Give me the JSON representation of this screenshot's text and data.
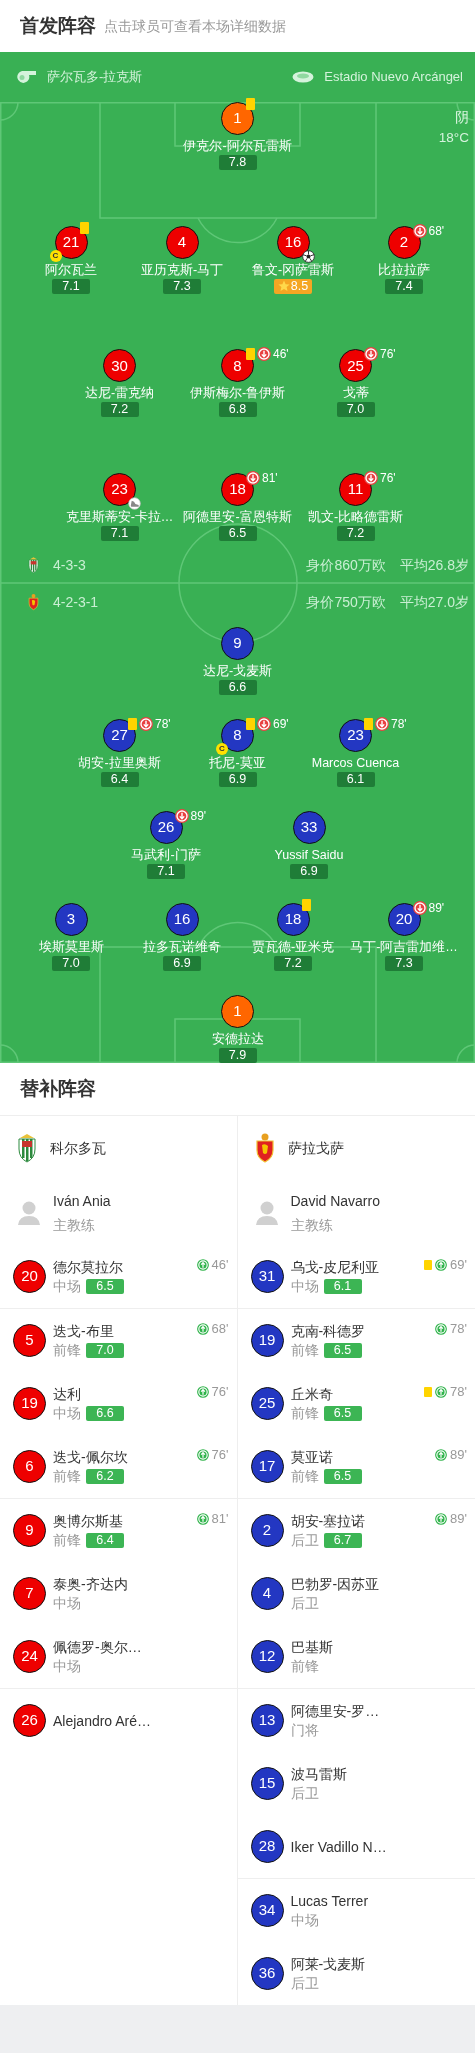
{
  "header": {
    "title": "首发阵容",
    "hint": "点击球员可查看本场详细数据"
  },
  "match_info": {
    "referee": "萨尔瓦多-拉克斯",
    "venue": "Estadio Nuevo Arcángel",
    "weather": "阴",
    "temperature": "18°C"
  },
  "teams": [
    {
      "color": "#ee0000",
      "formation": "4-3-3",
      "value": "身价860万欧",
      "avg_age": "平均26.8岁",
      "lines": [
        [
          {
            "number": "1",
            "name": "伊克尔-阿尔瓦雷斯",
            "rating": "7.8",
            "kind": "goalkeeper",
            "yellow_card": true
          }
        ],
        [
          {
            "number": "21",
            "name": "阿尔瓦兰",
            "rating": "7.1",
            "kind": "outfield",
            "yellow_card": true,
            "captain_badge": "C"
          },
          {
            "number": "4",
            "name": "亚历克斯-马丁",
            "rating": "7.3",
            "kind": "outfield",
            "yellow_card": false
          },
          {
            "number": "16",
            "name": "鲁文-冈萨雷斯",
            "rating": "8.5",
            "kind": "outfield",
            "yellow_card": false,
            "goal": true,
            "best": true
          },
          {
            "number": "2",
            "name": "比拉拉萨",
            "rating": "7.4",
            "kind": "outfield",
            "yellow_card": false,
            "sub_out": "68'"
          }
        ],
        [
          {
            "number": "30",
            "name": "达尼-雷克纳",
            "rating": "7.2",
            "kind": "outfield",
            "yellow_card": false
          },
          {
            "number": "8",
            "name": "伊斯梅尔-鲁伊斯",
            "rating": "6.8",
            "kind": "outfield",
            "yellow_card": true,
            "sub_out": "46'"
          },
          {
            "number": "25",
            "name": "戈蒂",
            "rating": "7.0",
            "kind": "outfield",
            "yellow_card": false,
            "sub_out": "76'"
          }
        ],
        [
          {
            "number": "23",
            "name": "克里斯蒂安-卡拉…",
            "rating": "7.1",
            "kind": "outfield",
            "yellow_card": false,
            "assist": true
          },
          {
            "number": "18",
            "name": "阿德里安-富恩特斯",
            "rating": "6.5",
            "kind": "outfield",
            "yellow_card": false,
            "sub_out": "81'"
          },
          {
            "number": "11",
            "name": "凯文-比略德雷斯",
            "rating": "7.2",
            "kind": "outfield",
            "yellow_card": false,
            "sub_out": "76'"
          }
        ]
      ]
    },
    {
      "color": "#2337c2",
      "formation": "4-2-3-1",
      "value": "身价750万欧",
      "avg_age": "平均27.0岁",
      "lines": [
        [
          {
            "number": "9",
            "name": "达尼-戈麦斯",
            "rating": "6.6",
            "kind": "outfield",
            "yellow_card": false
          }
        ],
        [
          {
            "number": "27",
            "name": "胡安-拉里奥斯",
            "rating": "6.4",
            "kind": "outfield",
            "yellow_card": true,
            "sub_out": "78'"
          },
          {
            "number": "8",
            "name": "托尼-莫亚",
            "rating": "6.9",
            "kind": "outfield",
            "yellow_card": true,
            "sub_out": "69'",
            "captain_badge": "C"
          },
          {
            "number": "23",
            "name": "Marcos Cuenca",
            "rating": "6.1",
            "kind": "outfield",
            "yellow_card": true,
            "sub_out": "78'"
          }
        ],
        [
          {
            "number": "26",
            "name": "马武利-门萨",
            "rating": "7.1",
            "kind": "outfield",
            "yellow_card": false,
            "sub_out": "89'"
          },
          {
            "number": "33",
            "name": "Yussif Saidu",
            "rating": "6.9",
            "kind": "outfield",
            "yellow_card": false
          }
        ],
        [
          {
            "number": "3",
            "name": "埃斯莫里斯",
            "rating": "7.0",
            "kind": "outfield",
            "yellow_card": false
          },
          {
            "number": "16",
            "name": "拉多瓦诺维奇",
            "rating": "6.9",
            "kind": "outfield",
            "yellow_card": false
          },
          {
            "number": "18",
            "name": "贾瓦德-亚米克",
            "rating": "7.2",
            "kind": "outfield",
            "yellow_card": true
          },
          {
            "number": "20",
            "name": "马丁-阿吉雷加维…",
            "rating": "7.3",
            "kind": "outfield",
            "yellow_card": false,
            "sub_out": "89'"
          }
        ],
        [
          {
            "number": "1",
            "name": "安德拉达",
            "rating": "7.9",
            "kind": "goalkeeper",
            "yellow_card": false
          }
        ]
      ]
    }
  ],
  "subs": {
    "title": "替补阵容",
    "teams": [
      {
        "color": "#ee0000",
        "name": "科尔多瓦",
        "coach": "Iván Ania",
        "coach_role": "主教练",
        "groups": [
          [
            {
              "number": "20",
              "name": "德尔莫拉尔",
              "position": "中场",
              "rating": "6.5",
              "sub_in": "46'",
              "yellow_card": false
            }
          ],
          [
            {
              "number": "5",
              "name": "迭戈-布里",
              "position": "前锋",
              "rating": "7.0",
              "sub_in": "68'",
              "yellow_card": false
            },
            {
              "number": "19",
              "name": "达利",
              "position": "中场",
              "rating": "6.6",
              "sub_in": "76'",
              "yellow_card": false
            },
            {
              "number": "6",
              "name": "迭戈-佩尔坎",
              "position": "前锋",
              "rating": "6.2",
              "sub_in": "76'",
              "yellow_card": false
            }
          ],
          [
            {
              "number": "9",
              "name": "奥博尔斯基",
              "position": "前锋",
              "rating": "6.4",
              "sub_in": "81'",
              "yellow_card": false
            },
            {
              "number": "7",
              "name": "泰奥-齐达内",
              "position": "中场",
              "yellow_card": false
            },
            {
              "number": "24",
              "name": "佩德罗-奥尔…",
              "position": "中场",
              "yellow_card": false
            }
          ],
          [
            {
              "number": "26",
              "name": "Alejandro Aré…",
              "yellow_card": false
            }
          ]
        ]
      },
      {
        "color": "#2337c2",
        "name": "萨拉戈萨",
        "coach": "David Navarro",
        "coach_role": "主教练",
        "groups": [
          [
            {
              "number": "31",
              "name": "乌戈-皮尼利亚",
              "position": "中场",
              "rating": "6.1",
              "sub_in": "69'",
              "yellow_card": true
            }
          ],
          [
            {
              "number": "19",
              "name": "克南-科德罗",
              "position": "前锋",
              "rating": "6.5",
              "sub_in": "78'",
              "yellow_card": false
            },
            {
              "number": "25",
              "name": "丘米奇",
              "position": "前锋",
              "rating": "6.5",
              "sub_in": "78'",
              "yellow_card": true
            },
            {
              "number": "17",
              "name": "莫亚诺",
              "position": "前锋",
              "rating": "6.5",
              "sub_in": "89'",
              "yellow_card": false
            }
          ],
          [
            {
              "number": "2",
              "name": "胡安-塞拉诺",
              "position": "后卫",
              "rating": "6.7",
              "sub_in": "89'",
              "yellow_card": false
            },
            {
              "number": "4",
              "name": "巴勃罗-因苏亚",
              "position": "后卫",
              "yellow_card": false
            },
            {
              "number": "12",
              "name": "巴基斯",
              "position": "前锋",
              "yellow_card": false
            }
          ],
          [
            {
              "number": "13",
              "name": "阿德里安-罗…",
              "position": "门将",
              "yellow_card": false
            },
            {
              "number": "15",
              "name": "波马雷斯",
              "position": "后卫",
              "yellow_card": false
            },
            {
              "number": "28",
              "name": "Iker Vadillo N…",
              "yellow_card": false
            }
          ],
          [
            {
              "number": "34",
              "name": "Lucas Terrer",
              "position": "中场",
              "yellow_card": false
            },
            {
              "number": "36",
              "name": "阿莱-戈麦斯",
              "position": "后卫",
              "yellow_card": false
            }
          ]
        ]
      }
    ]
  }
}
